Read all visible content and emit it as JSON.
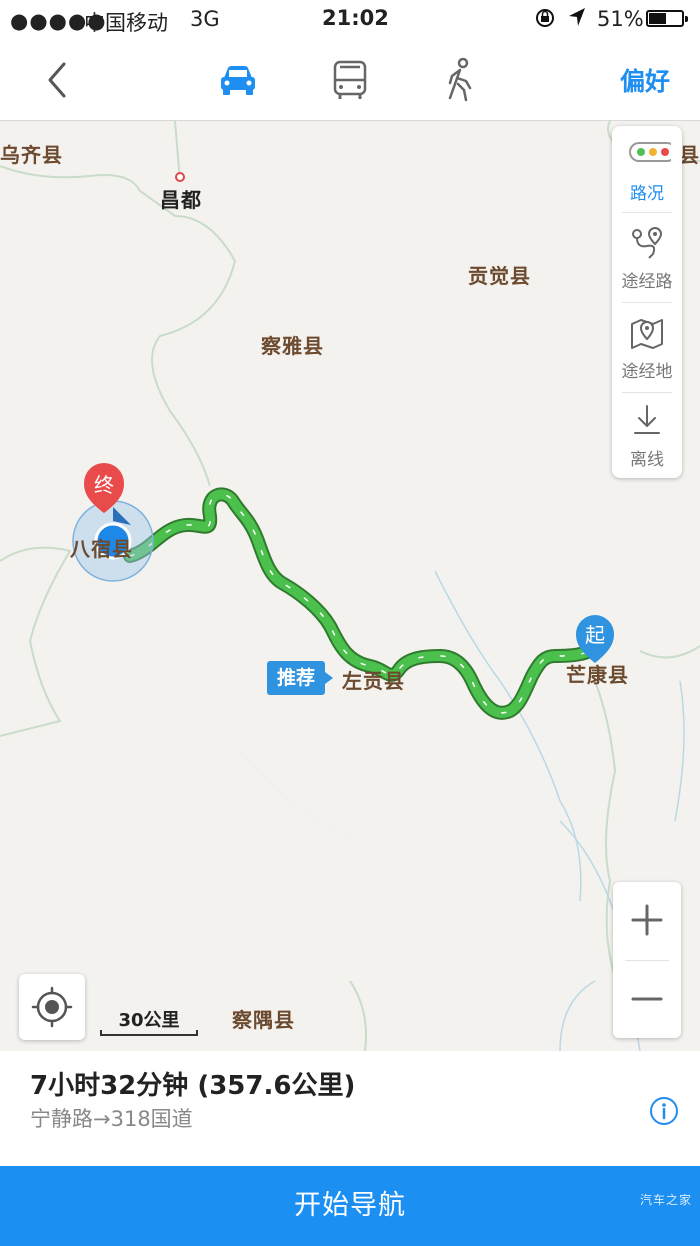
{
  "status_bar": {
    "signal": "●●●●●",
    "carrier": "中国移动",
    "network": "3G",
    "time": "21:02",
    "battery_percent": "51%",
    "battery_level": 0.51
  },
  "nav": {
    "modes": [
      "car-icon",
      "bus-icon",
      "walk-icon"
    ],
    "active_mode": "car",
    "preferences_label": "偏好",
    "accent_color": "#1f8ef1"
  },
  "map": {
    "labels": {
      "wuqi": "乌齐县",
      "changdu": "昌都",
      "gongjue": "贡觉县",
      "chaya": "察雅县",
      "basu": "八宿县",
      "zuogong": "左贡县",
      "mangkang": "芒康县",
      "chayu": "察隅县",
      "right_edge": "县"
    },
    "start_marker": "起",
    "end_marker": "终",
    "route_tag": "推荐",
    "route_color": "#3cb23c",
    "scale": "30公里"
  },
  "tools": {
    "traffic": "路况",
    "waypoint_route": "途经路",
    "waypoint_place": "途经地",
    "offline": "离线"
  },
  "summary": {
    "duration_distance": "7小时32分钟 (357.6公里)",
    "via": "宁静路→318国道"
  },
  "start_nav_label": "开始导航",
  "watermark": "汽车之家"
}
